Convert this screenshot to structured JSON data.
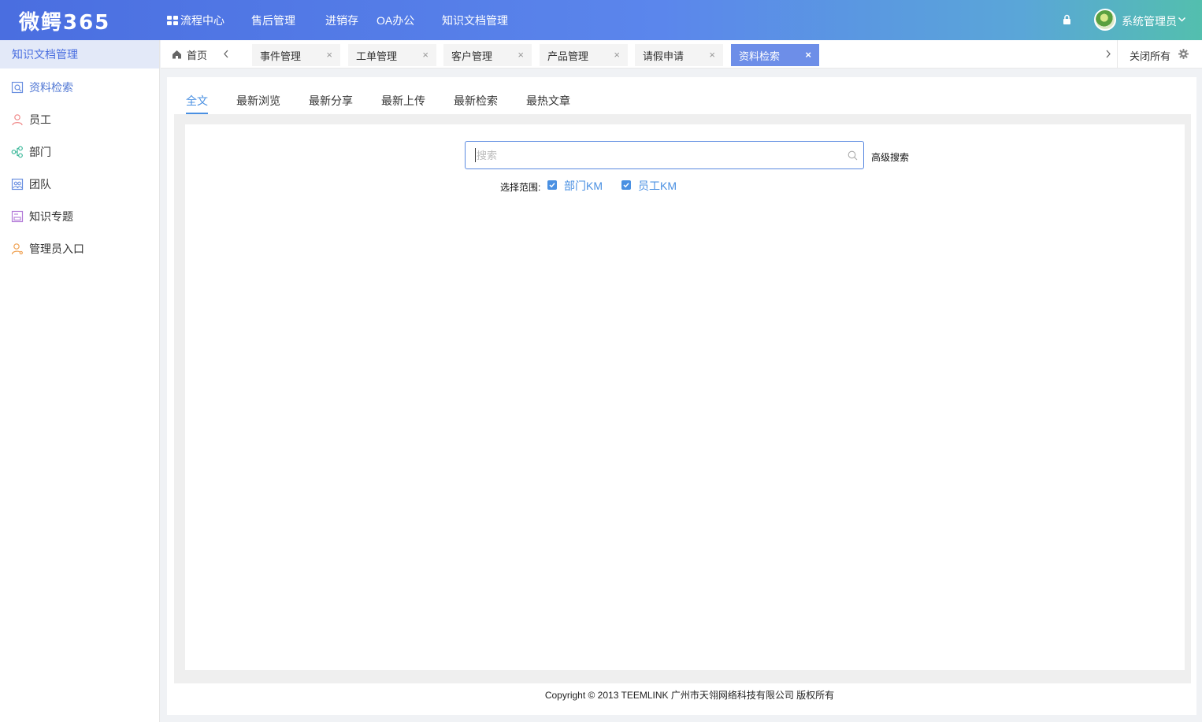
{
  "header": {
    "logo": "微鳄365",
    "nav": [
      "流程中心",
      "售后管理",
      "进销存",
      "OA办公",
      "知识文档管理"
    ],
    "user_name": "系统管理员"
  },
  "sidebar": {
    "title": "知识文档管理",
    "items": [
      {
        "label": "资料检索",
        "icon": "search-doc-icon"
      },
      {
        "label": "员工",
        "icon": "user-icon"
      },
      {
        "label": "部门",
        "icon": "org-icon"
      },
      {
        "label": "团队",
        "icon": "team-icon"
      },
      {
        "label": "知识专题",
        "icon": "topic-icon"
      },
      {
        "label": "管理员入口",
        "icon": "admin-icon"
      }
    ]
  },
  "tabs": {
    "home": "首页",
    "items": [
      "事件管理",
      "工单管理",
      "客户管理",
      "产品管理",
      "请假申请",
      "资料检索"
    ],
    "close_all": "关闭所有"
  },
  "main": {
    "sub_tabs": [
      "全文",
      "最新浏览",
      "最新分享",
      "最新上传",
      "最新检索",
      "最热文章"
    ],
    "search": {
      "placeholder": "搜索",
      "advanced": "高级搜索"
    },
    "scope": {
      "label": "选择范围:",
      "options": [
        {
          "label": "部门KM",
          "checked": true
        },
        {
          "label": "员工KM",
          "checked": true
        }
      ]
    },
    "footer": "Copyright © 2013 TEEMLINK 广州市天翎网络科技有限公司 版权所有"
  },
  "colors": {
    "accent": "#4a90e2",
    "header_start": "#4a6ee0",
    "header_end": "#53bfae",
    "active_tab": "#6d8ee8"
  }
}
